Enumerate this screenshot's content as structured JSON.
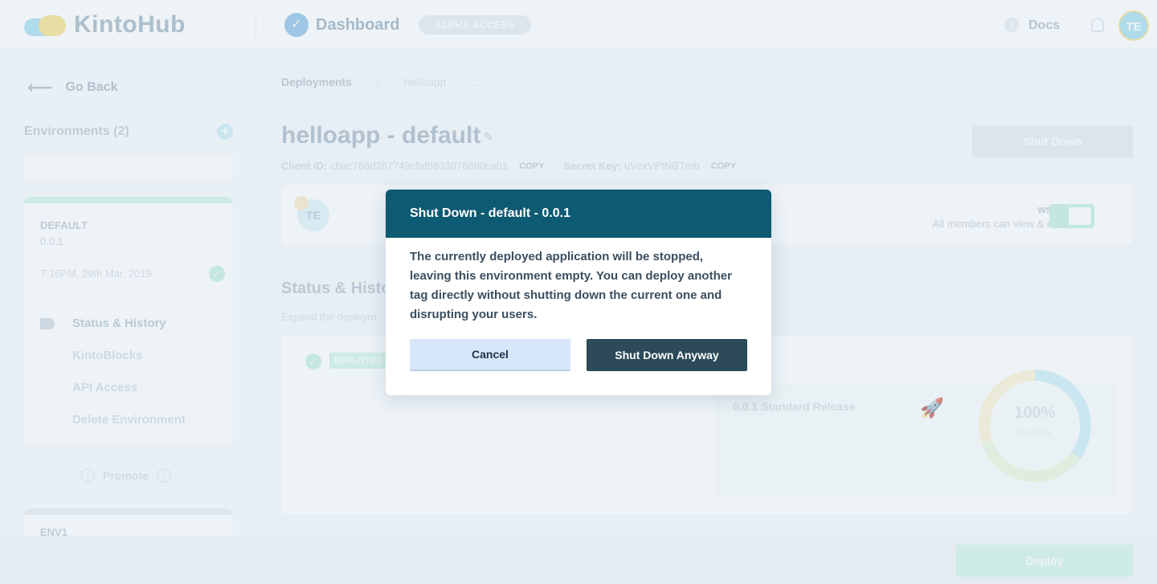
{
  "header": {
    "logo_text": "KintoHub",
    "section_title": "Dashboard",
    "section_icon": "check-circle-icon",
    "alpha_badge": "ALPHA ACCESS",
    "docs_label": "Docs",
    "user_initials": "TE"
  },
  "sidebar": {
    "go_back_label": "Go Back",
    "environments_header": "Environments (2)",
    "active_env": {
      "name": "DEFAULT",
      "version": "0.0.1",
      "deployed_at": "7:16PM, 29th Mar, 2019",
      "nav_items": [
        {
          "label": "Status & History"
        },
        {
          "label": "KintoBlocks"
        },
        {
          "label": "API Access"
        },
        {
          "label": "Delete Environment"
        }
      ]
    },
    "promote_label": "Promote",
    "second_env": {
      "name": "ENV1"
    }
  },
  "main": {
    "breadcrumb": [
      "Deployments",
      "helloapp",
      "..."
    ],
    "title": "helloapp - default",
    "shutdown_label": "Shut Down",
    "client_id_label": "Client ID:",
    "client_id_value": "cbac786d287749cfaf9833076880cab1",
    "secret_key_label": "Secret Key:",
    "secret_key_value": "uVcxVPtNBTmb",
    "copy_label": "COPY",
    "member_initials": "TE",
    "members_status_title": "wsed",
    "members_status_desc": "All members can view & edit",
    "status_title": "Status & Histo",
    "status_subtitle": "Expand the deploym",
    "deployed_badge": "DEPLOYED",
    "release_label": "0.0.1 Standard Release",
    "donut_percent": "100%",
    "donut_label": "Success"
  },
  "footer": {
    "deploy_label": "Deploy"
  },
  "modal": {
    "title": "Shut Down - default - 0.0.1",
    "body": "The currently deployed application will be stopped, leaving this environment empty. You can deploy another tag directly without shutting down the current one and disrupting your users.",
    "cancel_label": "Cancel",
    "confirm_label": "Shut Down Anyway"
  },
  "colors": {
    "modal_header": "#0d5a73",
    "confirm_button": "#2c4a57",
    "cancel_button": "#d8e6fb",
    "accent_green": "#b5ead4"
  }
}
